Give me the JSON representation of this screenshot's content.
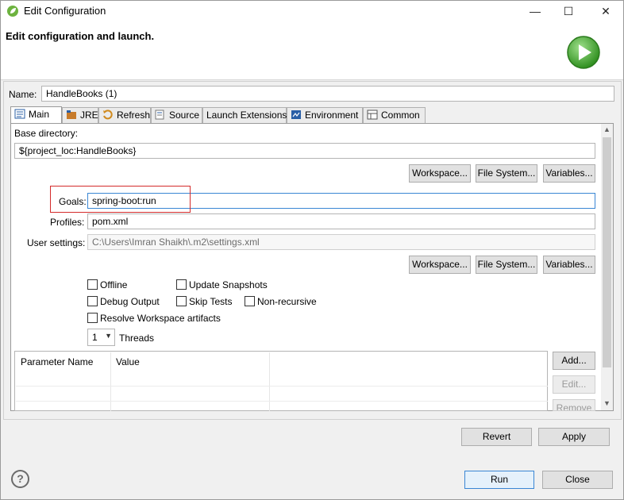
{
  "window": {
    "title": "Edit Configuration",
    "minimize_glyph": "—",
    "maximize_glyph": "☐",
    "close_glyph": "✕"
  },
  "header": {
    "title": "Edit configuration and launch."
  },
  "name_field": {
    "label": "Name:",
    "value": "HandleBooks (1)"
  },
  "tabs": [
    {
      "label": "Main",
      "icon": "main-tab-icon",
      "active": true
    },
    {
      "label": "JRE",
      "icon": "jre-icon"
    },
    {
      "label": "Refresh",
      "icon": "refresh-icon"
    },
    {
      "label": "Source",
      "icon": "source-icon"
    },
    {
      "label": "Launch Extensions",
      "icon": ""
    },
    {
      "label": "Environment",
      "icon": "environment-icon"
    },
    {
      "label": "Common",
      "icon": "common-icon"
    }
  ],
  "main": {
    "base_directory": {
      "label": "Base directory:",
      "value": "${project_loc:HandleBooks}",
      "buttons": [
        "Workspace...",
        "File System...",
        "Variables..."
      ]
    },
    "goals": {
      "label": "Goals:",
      "value": "spring-boot:run"
    },
    "profiles": {
      "label": "Profiles:",
      "value": "pom.xml"
    },
    "user_settings": {
      "label": "User settings:",
      "placeholder": "C:\\Users\\Imran Shaikh\\.m2\\settings.xml",
      "buttons": [
        "Workspace...",
        "File System...",
        "Variables..."
      ]
    },
    "options": {
      "offline": "Offline",
      "update_snapshots": "Update Snapshots",
      "debug_output": "Debug Output",
      "skip_tests": "Skip Tests",
      "non_recursive": "Non-recursive",
      "resolve_workspace": "Resolve Workspace artifacts"
    },
    "threads": {
      "value": "1",
      "label": "Threads"
    },
    "params_table": {
      "columns": [
        "Parameter Name",
        "Value"
      ],
      "buttons": {
        "add": "Add...",
        "edit": "Edit...",
        "remove": "Remove"
      }
    }
  },
  "footer": {
    "revert": "Revert",
    "apply": "Apply",
    "run": "Run",
    "close": "Close",
    "help_glyph": "?"
  },
  "colors": {
    "highlight": "#d42b2b",
    "focus": "#3a86d4",
    "launch_green": "#3aa329"
  }
}
